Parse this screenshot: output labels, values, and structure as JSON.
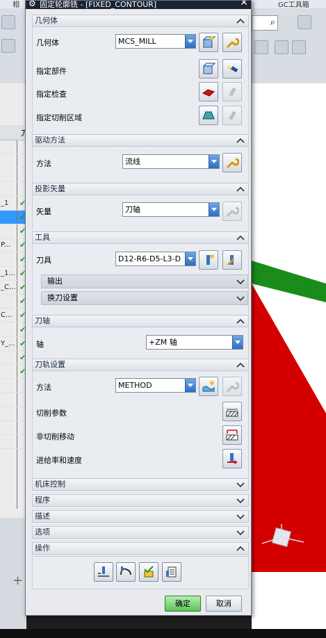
{
  "window": {
    "title": "固定轮廓铣 - [FIXED_CONTOUR]"
  },
  "background": {
    "menu_items": [
      "相",
      "GC工具箱"
    ],
    "search_glyph": "⌕",
    "tree_rows": [
      "",
      "",
      "",
      "",
      "_1",
      "",
      "",
      "P...",
      "",
      "_1...",
      "_C...",
      "",
      "C...",
      "",
      "Y_...",
      "",
      "",
      "",
      "",
      "",
      "",
      ""
    ],
    "tree_col_header": "刀",
    "bottom_glyph": "+"
  },
  "sections": {
    "geometry": {
      "header": "几何体",
      "geometry_label": "几何体",
      "geometry_value": "MCS_MILL",
      "part_label": "指定部件",
      "check_label": "指定检查",
      "cut_area_label": "指定切削区域"
    },
    "drive": {
      "header": "驱动方法",
      "method_label": "方法",
      "method_value": "流线"
    },
    "projection": {
      "header": "投影矢量",
      "vector_label": "矢量",
      "vector_value": "刀轴"
    },
    "tool": {
      "header": "工具",
      "tool_label": "刀具",
      "tool_value": "D12-R6-D5-L3-D",
      "output_label": "输出",
      "tool_change_label": "换刀设置"
    },
    "tool_axis": {
      "header": "刀轴",
      "axis_label": "轴",
      "axis_value": "+ZM 轴"
    },
    "path_settings": {
      "header": "刀轨设置",
      "method_label": "方法",
      "method_value": "METHOD",
      "cut_params_label": "切削参数",
      "non_cut_label": "非切削移动",
      "feeds_label": "进给率和速度"
    },
    "machine_control": {
      "header": "机床控制"
    },
    "program": {
      "header": "程序"
    },
    "description": {
      "header": "描述"
    },
    "options": {
      "header": "选项"
    },
    "actions": {
      "header": "操作"
    }
  },
  "buttons": {
    "ok": "确定",
    "cancel": "取消"
  },
  "colors": {
    "title_bar": "#1a2333",
    "ok_green": "#5dc15a",
    "viewport_red": "#d40000",
    "viewport_green": "#1a8c1a",
    "dropdown_blue": "#2a6fc4"
  }
}
